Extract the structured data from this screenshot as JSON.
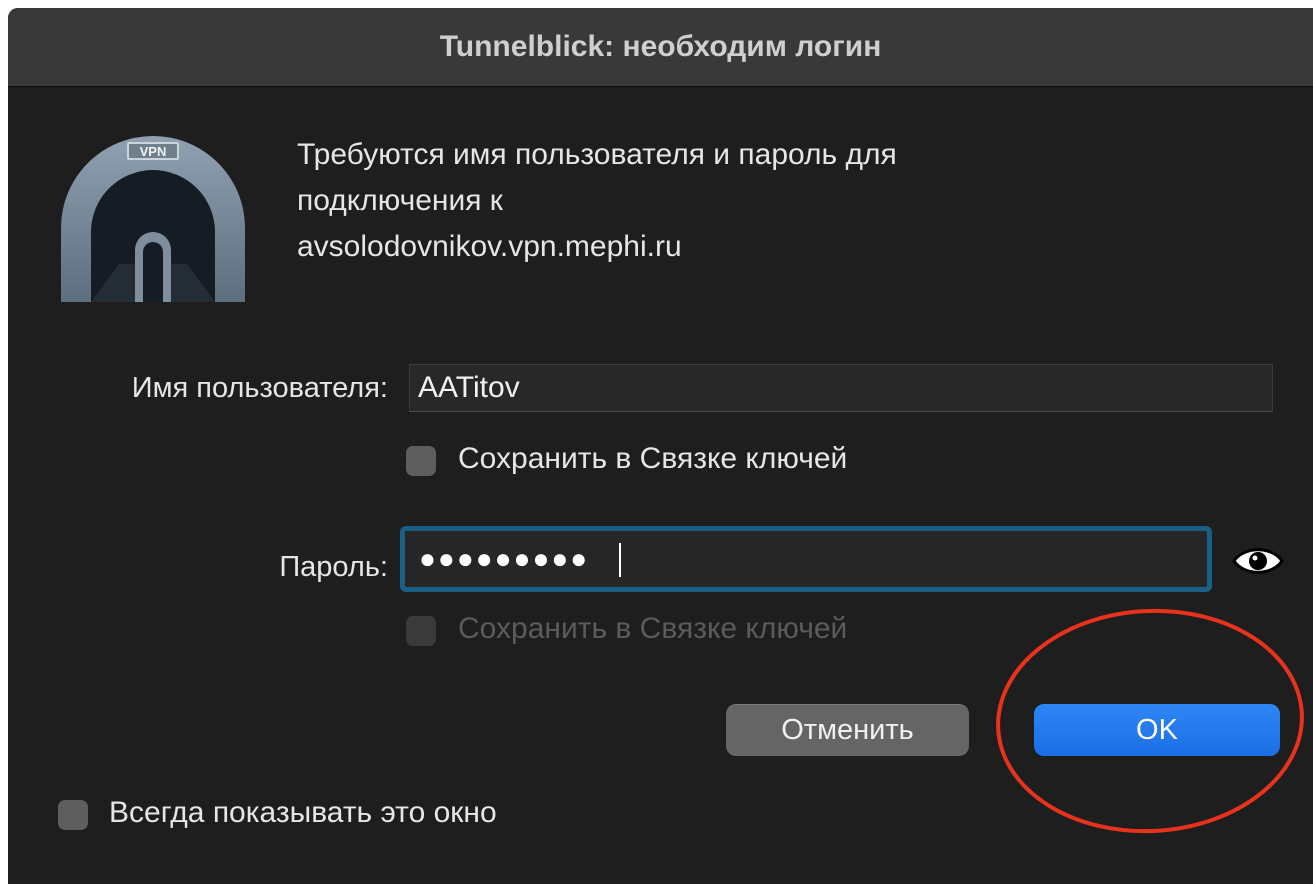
{
  "window": {
    "title": "Tunnelblick: необходим логин"
  },
  "message": {
    "line1": "Требуются имя пользователя и пароль для",
    "line2": "подключения к",
    "line3": "avsolodovnikov.vpn.mephi.ru"
  },
  "icon": {
    "name": "vpn-tunnel-icon",
    "badge_text": "VPN"
  },
  "username": {
    "label": "Имя пользователя:",
    "value": "AATitov",
    "keychain_label": "Сохранить в Связке ключей",
    "keychain_checked": false
  },
  "password": {
    "label": "Пароль:",
    "masked_value": "●●●●●●●●●",
    "keychain_label": "Сохранить в Связке ключей",
    "keychain_checked": false,
    "keychain_enabled": false,
    "reveal_icon": "eye-icon"
  },
  "buttons": {
    "cancel": "Отменить",
    "ok": "OK"
  },
  "footer": {
    "always_show_label": "Всегда показывать это окно",
    "always_show_checked": false
  },
  "colors": {
    "window_bg": "#1e1e1e",
    "titlebar_bg": "#393939",
    "focus_ring": "#1b5f85",
    "ok_button": "#1a6fe6",
    "annotation_circle": "#e8321c"
  }
}
